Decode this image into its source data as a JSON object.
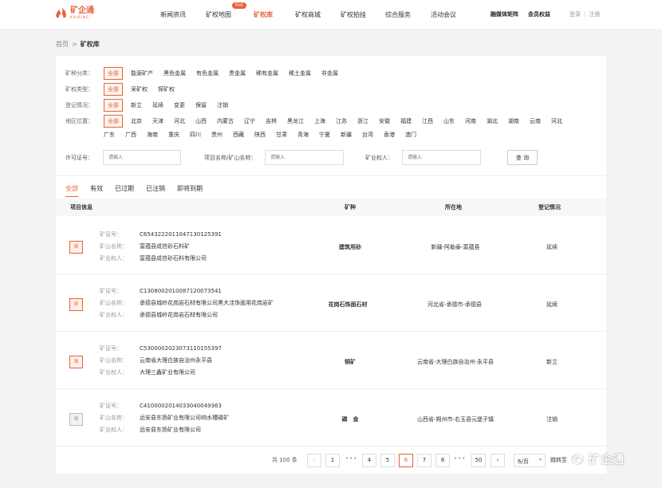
{
  "brand": {
    "name_cn": "矿企通",
    "name_en": "KHIKING",
    "accent_color": "#e8603a",
    "logo_icon": "flame-logo-icon"
  },
  "nav": {
    "items": [
      {
        "label": "新闻资讯"
      },
      {
        "label": "矿权地图"
      },
      {
        "label": "矿权库"
      },
      {
        "label": "矿权商城"
      },
      {
        "label": "矿权拍挂"
      },
      {
        "label": "综合服务"
      },
      {
        "label": "活动会议"
      }
    ],
    "hot_badge": "hot",
    "right_links": [
      "融媒体矩阵",
      "会员权益"
    ],
    "login": "登录",
    "register": "注册",
    "separator": "|"
  },
  "breadcrumb": {
    "home": "首页",
    "arrow": ">",
    "current": "矿权库"
  },
  "filters": {
    "mineral": {
      "label": "矿种分类：",
      "options": [
        "全部",
        "能源矿产",
        "黑色金属",
        "有色金属",
        "贵金属",
        "稀有金属",
        "稀土金属",
        "非金属"
      ]
    },
    "right_type": {
      "label": "矿权类型：",
      "options": [
        "全部",
        "采矿权",
        "探矿权"
      ]
    },
    "registration": {
      "label": "登记情况：",
      "options": [
        "全部",
        "新立",
        "延续",
        "变更",
        "保留",
        "注销"
      ]
    },
    "region": {
      "label": "地区位置：",
      "row1": [
        "全部",
        "北京",
        "天津",
        "河北",
        "山西",
        "内蒙古",
        "辽宁",
        "吉林",
        "黑龙江",
        "上海",
        "江苏",
        "浙江",
        "安徽",
        "福建",
        "江西",
        "山东",
        "河南",
        "湖北",
        "湖南",
        "云南",
        "河北"
      ],
      "row2": [
        "广东",
        "广西",
        "海南",
        "重庆",
        "四川",
        "贵州",
        "西藏",
        "陕西",
        "甘肃",
        "青海",
        "宁夏",
        "新疆",
        "台湾",
        "香港",
        "澳门"
      ]
    }
  },
  "search": {
    "license_label": "许可证号：",
    "license_placeholder": "请输入",
    "project_label": "项目名称/矿山名称：",
    "project_placeholder": "请输入",
    "owner_label": "矿业权人：",
    "owner_placeholder": "请输入",
    "query_button": "查 询"
  },
  "status_tabs": [
    "全部",
    "有效",
    "已过期",
    "已注销",
    "即将到期"
  ],
  "table": {
    "headers": [
      "项目信息",
      "矿种",
      "所在地",
      "登记情况"
    ],
    "key_labels": {
      "license": "矿证号：",
      "mine": "矿山名称：",
      "owner": "矿业权人："
    },
    "rows": [
      {
        "icon_label": "采",
        "license_label": "矿证号：",
        "license": "C6543222011047130125391",
        "mine": "富蕴县成信砂石料矿",
        "owner": "富蕴县成信砂石料有限公司",
        "mineral": "建筑用砂",
        "location": "新疆-阿勒泰-富蕴县",
        "status": "延续"
      },
      {
        "icon_label": "采",
        "license_label": "矿证号：",
        "license": "C1308002010087120073541",
        "mine": "承德县城岭花岗岩石材有限公司黑大洼饰面用花岗岩矿",
        "owner": "承德县城岭花岗岩石材有限公司",
        "mineral": "花岗石饰面石材",
        "location": "河北省-承德市-承德县",
        "status": "延续"
      },
      {
        "icon_label": "采",
        "license_label": "矿证号：",
        "license": "C5300002023073110155397",
        "mine": "云南省大理白族自治州永平县",
        "owner": "大理三鑫矿业有限公司",
        "mineral": "铜矿",
        "location": "云南省-大理白族自治州-永平县",
        "status": "新立"
      },
      {
        "icon_label": "采",
        "license_label": "矿证号：",
        "license": "C4100002014033040049363",
        "mine": "远安县东扬矿业有限公司响水槽磷矿",
        "owner": "远安县东扬矿业有限公司",
        "mineral": "磷　金",
        "location": "山西省-朔州市-右玉县元堡子镇",
        "status": "注销"
      }
    ]
  },
  "pagination": {
    "total": "共 100 条",
    "prev": "‹",
    "next": "›",
    "pages": [
      "1",
      "4",
      "5",
      "6",
      "7",
      "8",
      "50"
    ],
    "current_page": "6",
    "ellipsis": "•••",
    "page_size": "6/页",
    "jump_label": "跳转至"
  },
  "watermark": {
    "text": "矿企通",
    "icon": "wechat-icon"
  }
}
